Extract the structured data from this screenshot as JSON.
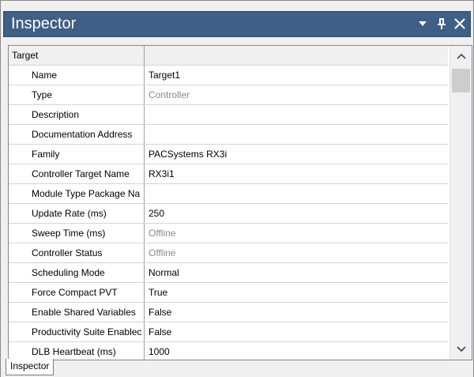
{
  "window": {
    "title": "Inspector",
    "buttons": {
      "dropdown": "dropdown-arrow-icon",
      "pin": "pin-icon",
      "close": "close-icon"
    }
  },
  "grid": {
    "category": {
      "name": "Target",
      "value": ""
    },
    "rows": [
      {
        "name": "Name",
        "value": "Target1",
        "dim": false
      },
      {
        "name": "Type",
        "value": "Controller",
        "dim": true
      },
      {
        "name": "Description",
        "value": "",
        "dim": false
      },
      {
        "name": "Documentation Address",
        "value": "",
        "dim": false
      },
      {
        "name": "Family",
        "value": "PACSystems RX3i",
        "dim": false
      },
      {
        "name": "Controller Target Name",
        "value": "RX3i1",
        "dim": false
      },
      {
        "name": "Module Type Package Na",
        "value": "",
        "dim": false
      },
      {
        "name": "Update Rate (ms)",
        "value": "250",
        "dim": false
      },
      {
        "name": "Sweep Time (ms)",
        "value": "Offline",
        "dim": true
      },
      {
        "name": "Controller Status",
        "value": "Offline",
        "dim": true
      },
      {
        "name": "Scheduling Mode",
        "value": "Normal",
        "dim": false
      },
      {
        "name": "Force Compact PVT",
        "value": "True",
        "dim": false
      },
      {
        "name": "Enable Shared Variables",
        "value": "False",
        "dim": false
      },
      {
        "name": "Productivity Suite Enablec",
        "value": "False",
        "dim": false
      },
      {
        "name": "DLB Heartbeat (ms)",
        "value": "1000",
        "dim": false
      }
    ]
  },
  "scrollbar": {
    "up_icon": "chevron-up-icon",
    "down_icon": "chevron-down-icon"
  },
  "tabs": [
    {
      "label": "Inspector"
    }
  ],
  "colors": {
    "titlebar": "#3f5f86",
    "dim_text": "#8a8a8a",
    "grid_line": "#d4d4d4"
  }
}
